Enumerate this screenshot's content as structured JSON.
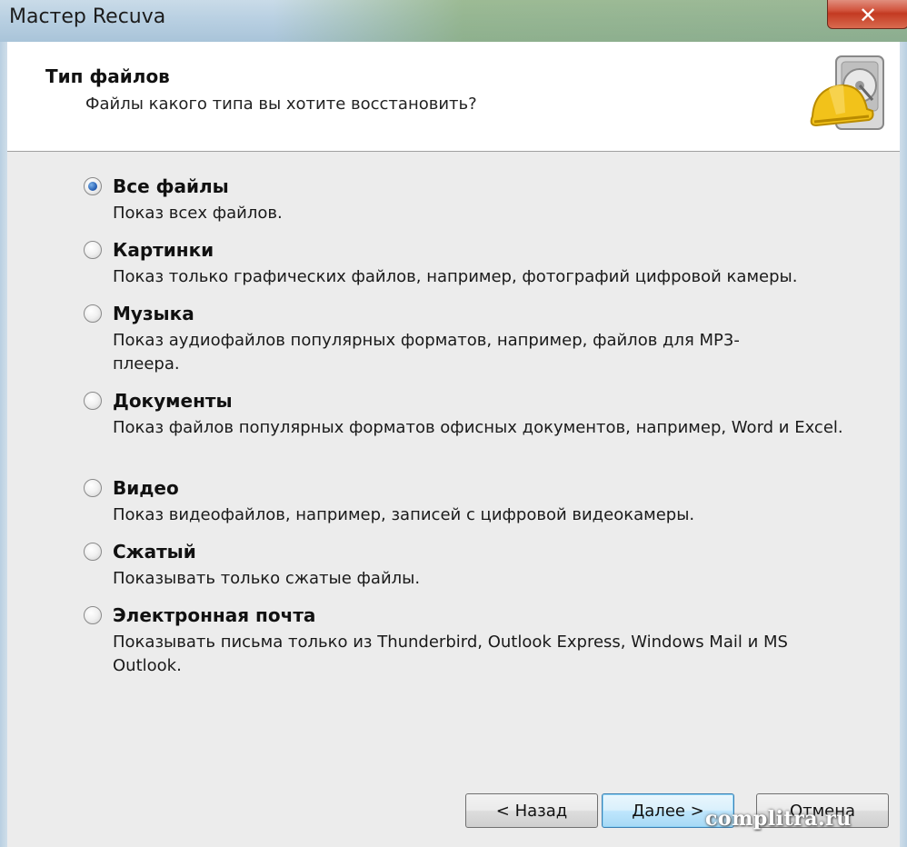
{
  "window": {
    "title": "Мастер Recuva",
    "close_glyph": "✕"
  },
  "header": {
    "title": "Тип файлов",
    "subtitle": "Файлы какого типа вы хотите восстановить?",
    "logo_icon": "hard-drive-hardhat-icon"
  },
  "options": [
    {
      "label": "Все файлы",
      "description": "Показ всех файлов.",
      "selected": true
    },
    {
      "label": "Картинки",
      "description": "Показ только графических файлов, например, фотографий цифровой камеры.",
      "selected": false
    },
    {
      "label": "Музыка",
      "description": "Показ аудиофайлов популярных форматов, например, файлов для MP3-плеера.",
      "selected": false
    },
    {
      "label": "Документы",
      "description": "Показ файлов популярных форматов офисных документов, например, Word и Excel.",
      "selected": false
    },
    {
      "label": "Видео",
      "description": "Показ видеофайлов, например, записей с цифровой видеокамеры.",
      "selected": false
    },
    {
      "label": "Сжатый",
      "description": "Показывать только сжатые файлы.",
      "selected": false
    },
    {
      "label": "Электронная почта",
      "description": "Показывать письма только из Thunderbird, Outlook Express, Windows Mail и MS Outlook.",
      "selected": false
    }
  ],
  "buttons": {
    "back": "< Назад",
    "next": "Далее >",
    "cancel": "Отмена"
  },
  "watermark": "complitra.ru",
  "colors": {
    "close_button": "#c94a31",
    "header_bg": "#ffffff",
    "panel_bg": "#ececec",
    "radio_selected": "#2a64b8"
  }
}
